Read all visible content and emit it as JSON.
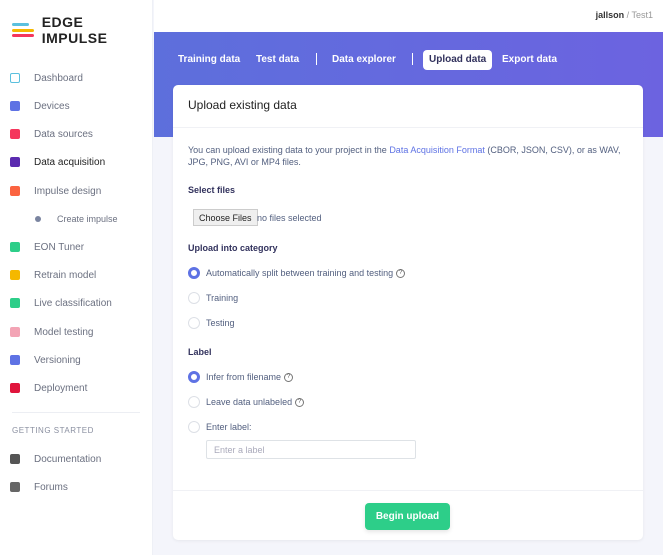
{
  "app": {
    "logo_text": "EDGE IMPULSE"
  },
  "sidebar": {
    "items": [
      {
        "label": "Dashboard",
        "icon": "monitor-icon",
        "color": "#5bc0de"
      },
      {
        "label": "Devices",
        "icon": "chip-icon",
        "color": "#5e72e4"
      },
      {
        "label": "Data sources",
        "icon": "wand-icon",
        "color": "#f5365c"
      },
      {
        "label": "Data acquisition",
        "icon": "database-icon",
        "color": "#5b2bb0"
      },
      {
        "label": "Impulse design",
        "icon": "pulse-icon",
        "color": "#fb6340"
      },
      {
        "label": "Create impulse",
        "icon": "dot-icon",
        "color": "#7a84a0"
      },
      {
        "label": "EON Tuner",
        "icon": "compass-icon",
        "color": "#2dce89"
      },
      {
        "label": "Retrain model",
        "icon": "shuffle-icon",
        "color": "#f5b800"
      },
      {
        "label": "Live classification",
        "icon": "live-icon",
        "color": "#2dce89"
      },
      {
        "label": "Model testing",
        "icon": "clipboard-icon",
        "color": "#f3a4b5"
      },
      {
        "label": "Versioning",
        "icon": "branch-icon",
        "color": "#5e72e4"
      },
      {
        "label": "Deployment",
        "icon": "gift-icon",
        "color": "#e0143c"
      }
    ],
    "section": "GETTING STARTED",
    "extra": [
      {
        "label": "Documentation",
        "icon": "docs-icon",
        "color": "#555"
      },
      {
        "label": "Forums",
        "icon": "chat-icon",
        "color": "#666"
      }
    ]
  },
  "topbar": {
    "user": "jallson",
    "separator": "/",
    "project": "Test1"
  },
  "tabs": [
    "Training data",
    "Test data",
    "Data explorer",
    "Upload data",
    "Export data"
  ],
  "card": {
    "title": "Upload existing data",
    "desc_pre": "You can upload existing data to your project in the ",
    "desc_link": "Data Acquisition Format",
    "desc_post": " (CBOR, JSON, CSV), or as WAV, JPG, PNG, AVI or MP4 files.",
    "select_files": "Select files",
    "choose_files": "Choose Files",
    "no_files": "no files selected",
    "category_label": "Upload into category",
    "category_options": [
      "Automatically split between training and testing",
      "Training",
      "Testing"
    ],
    "label_label": "Label",
    "label_options": [
      "Infer from filename",
      "Leave data unlabeled",
      "Enter label:"
    ],
    "label_placeholder": "Enter a label",
    "help": "?",
    "begin_upload": "Begin upload"
  }
}
